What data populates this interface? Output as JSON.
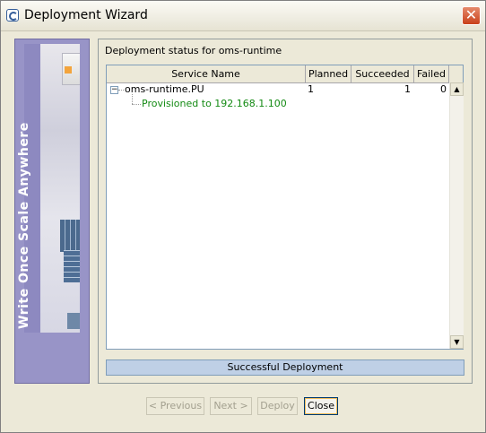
{
  "window": {
    "title": "Deployment Wizard",
    "close_glyph": "✕"
  },
  "sidebar": {
    "banner_text": "Write Once Scale Anywhere"
  },
  "main": {
    "status_label": "Deployment status for oms-runtime",
    "table": {
      "columns": [
        "Service Name",
        "Planned",
        "Succeeded",
        "Failed"
      ],
      "rows": [
        {
          "name": "oms-runtime.PU",
          "expander": "−",
          "planned": "1",
          "succeeded": "1",
          "failed": "0",
          "children": [
            "Provisioned to 192.168.1.100"
          ]
        }
      ]
    },
    "progress_text": "Successful Deployment"
  },
  "buttons": {
    "previous": "< Previous",
    "next": "Next >",
    "deploy": "Deploy",
    "close": "Close"
  },
  "scroll": {
    "up_icon": "▲",
    "down_icon": "▼"
  },
  "colors": {
    "child_text": "#138a13",
    "sidebar": "#9894c7",
    "progress_fill": "#bfd0e6"
  }
}
